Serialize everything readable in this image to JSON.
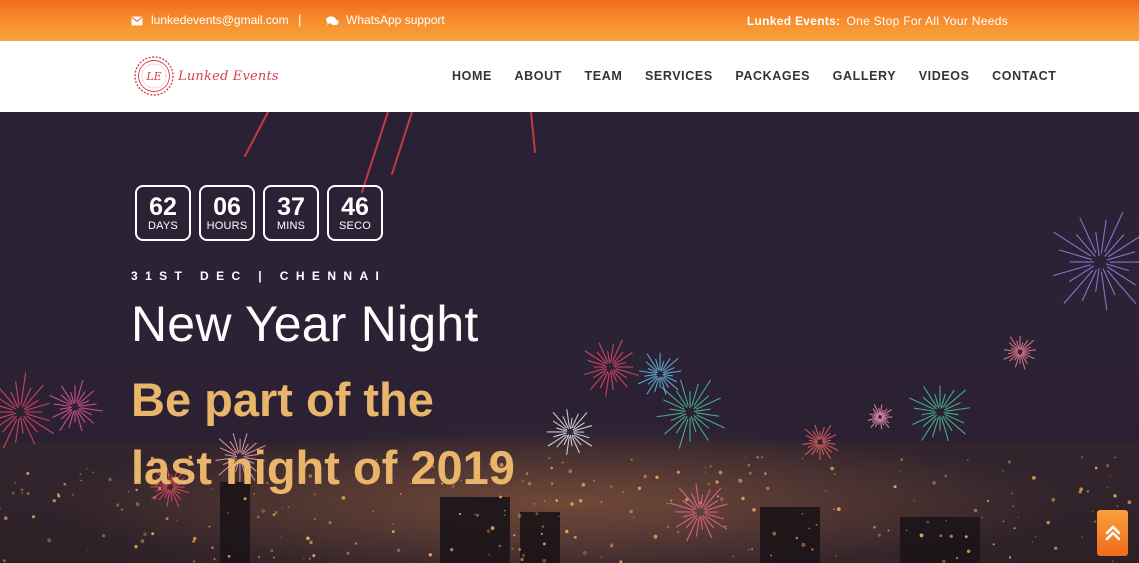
{
  "topbar": {
    "email": "lunkedevents@gmail.com",
    "divider": "|",
    "whatsapp": "WhatsApp support",
    "tagline_brand": "Lunked Events:",
    "tagline_text": "One Stop For All Your Needs"
  },
  "logo": {
    "text": "Lunked Events",
    "monogram": "LE"
  },
  "nav": {
    "items": [
      {
        "label": "HOME"
      },
      {
        "label": "ABOUT"
      },
      {
        "label": "TEAM"
      },
      {
        "label": "SERVICES"
      },
      {
        "label": "PACKAGES"
      },
      {
        "label": "GALLERY"
      },
      {
        "label": "VIDEOS"
      },
      {
        "label": "CONTACT"
      }
    ]
  },
  "countdown": [
    {
      "value": "62",
      "unit": "DAYS"
    },
    {
      "value": "06",
      "unit": "HOURS"
    },
    {
      "value": "37",
      "unit": "MINS"
    },
    {
      "value": "46",
      "unit": "SECO"
    }
  ],
  "hero": {
    "meta": "31ST DEC | CHENNAI",
    "title": "New Year Night",
    "subtitle_line1": "Be part of the",
    "subtitle_line2": "last night of 2019"
  },
  "colors": {
    "accent_orange": "#f46a1e",
    "accent_gold": "#e8b56a",
    "logo_red": "#d3434f"
  },
  "icons": {
    "email": "envelope-icon",
    "whatsapp": "chat-bubbles-icon",
    "scroll_top": "double-chevron-up-icon"
  }
}
